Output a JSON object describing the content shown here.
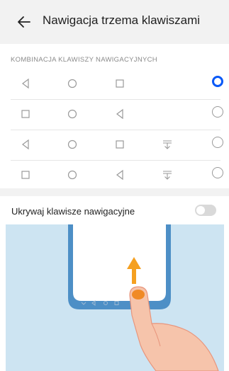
{
  "header": {
    "title": "Nawigacja trzema klawiszami",
    "back_icon": "arrow-left-icon"
  },
  "section_title": "KOMBINACJA KLAWISZY NAWIGACYJNYCH",
  "combinations": [
    {
      "keys": [
        "back-triangle-icon",
        "home-circle-icon",
        "recents-square-icon"
      ],
      "selected": true
    },
    {
      "keys": [
        "recents-square-icon",
        "home-circle-icon",
        "back-triangle-icon"
      ],
      "selected": false
    },
    {
      "keys": [
        "back-triangle-icon",
        "home-circle-icon",
        "recents-square-icon",
        "notification-pull-icon"
      ],
      "selected": false
    },
    {
      "keys": [
        "recents-square-icon",
        "home-circle-icon",
        "back-triangle-icon",
        "notification-pull-icon"
      ],
      "selected": false
    }
  ],
  "hide_keys": {
    "label": "Ukrywaj klawisze nawigacyjne",
    "enabled": false
  },
  "colors": {
    "accent": "#0a59f7",
    "illustration_bg": "#cde4f2",
    "phone_frame": "#4d8fc6",
    "arrow": "#f5a020"
  }
}
